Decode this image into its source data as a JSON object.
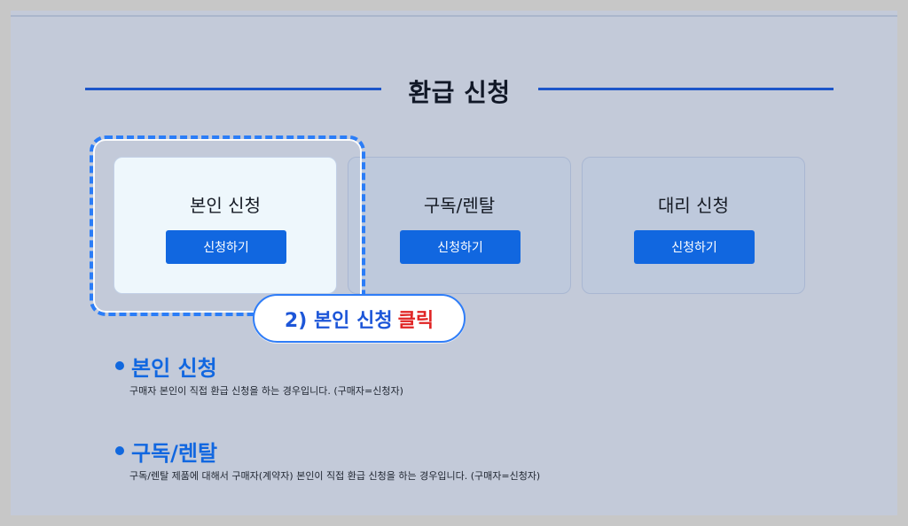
{
  "section": {
    "title": "환급 신청"
  },
  "cards": [
    {
      "title": "본인 신청",
      "button": "신청하기"
    },
    {
      "title": "구독/렌탈",
      "button": "신청하기"
    },
    {
      "title": "대리 신청",
      "button": "신청하기"
    }
  ],
  "callout": {
    "main": "2) 본인 신청",
    "accent": "클릭"
  },
  "info": [
    {
      "title": "본인 신청",
      "desc": "구매자 본인이 직접 환급 신청을 하는 경우입니다. (구매자=신청자)"
    },
    {
      "title": "구독/렌탈",
      "desc": "구독/렌탈 제품에 대해서 구매자(계약자) 본인이 직접 환급 신청을 하는 경우입니다. (구매자=신청자)"
    }
  ],
  "colors": {
    "background": "#c3cad9",
    "accent_blue": "#1167e0",
    "highlight_blue": "#2b7df7",
    "alert_red": "#e02424"
  },
  "icons": {
    "bullet": "dot-bullet-icon"
  }
}
